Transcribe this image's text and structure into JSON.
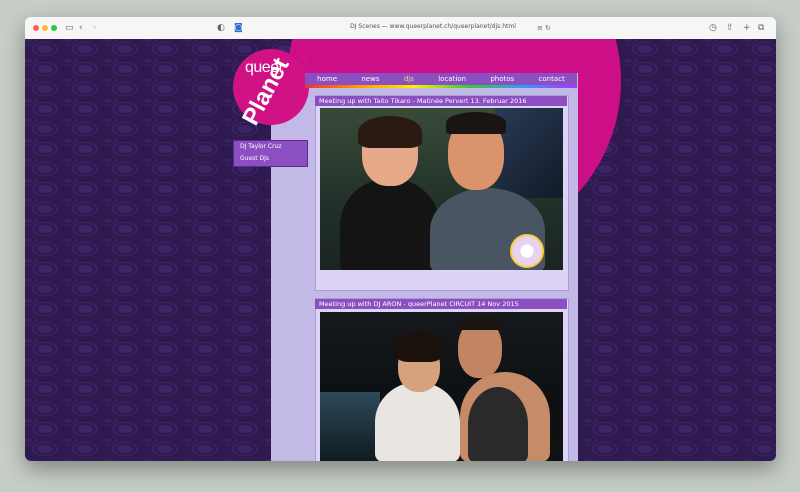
{
  "browser": {
    "url_text": "DJ Scenes — www.queerplanet.ch/queerplanet/djs.html",
    "traffic_light_colors": [
      "#ff5f57",
      "#febc2e",
      "#28c840"
    ],
    "icons": [
      "sidebar-icon",
      "back-icon",
      "forward-icon",
      "shield-icon",
      "camera-icon",
      "reader-icon",
      "refresh-icon",
      "clock-icon",
      "share-icon",
      "new-tab-icon",
      "tabs-icon"
    ]
  },
  "logo": {
    "word1": "queer",
    "word2": "Planet"
  },
  "nav": {
    "items": [
      "home",
      "news",
      "djs",
      "location",
      "photos",
      "contact"
    ],
    "active": "djs"
  },
  "sidebar": {
    "items": [
      "DJ Taylor Cruz",
      "Guest DJs"
    ]
  },
  "posts": [
    {
      "title": "Meeting up with Taito Tikaro - Matinée Pervert 13. Februar 2016"
    },
    {
      "title": "Meeting up with DJ ARON - queerPlanet CIRCUIT 14 Nov 2015"
    }
  ],
  "colors": {
    "background": "#2f1a4f",
    "circle": "#cc0f86",
    "nav": "#8b4fc2",
    "panel": "#dcd3f6",
    "active_nav": "#ffd66b"
  }
}
